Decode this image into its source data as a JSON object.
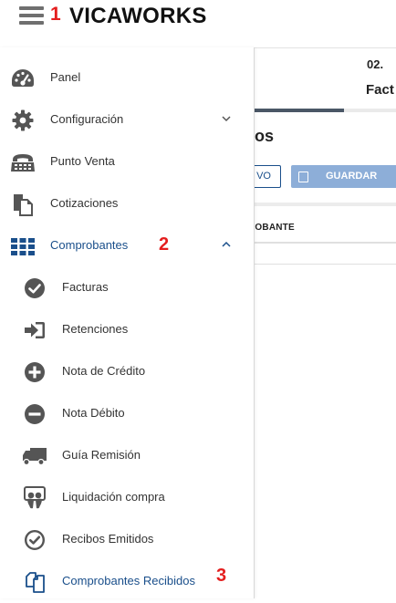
{
  "header": {
    "brand": "VICAWORKS",
    "step_marker": "1"
  },
  "background": {
    "step_number": "02.",
    "step_title": "Fact",
    "progress": 0.62,
    "section_title": "dos",
    "btn_nuevo": "VO",
    "btn_guardar": "GUARDAR",
    "column_header": "ROBANTE"
  },
  "sidebar": {
    "items": [
      {
        "label": "Panel",
        "icon": "dashboard-gauge-icon"
      },
      {
        "label": "Configuración",
        "icon": "gear-icon",
        "expandable": true
      },
      {
        "label": "Punto Venta",
        "icon": "cash-register-icon"
      },
      {
        "label": "Cotizaciones",
        "icon": "documents-icon"
      },
      {
        "label": "Comprobantes",
        "icon": "grid-icon",
        "expanded": true,
        "active": true,
        "step_marker": "2"
      }
    ],
    "subitems": [
      {
        "label": "Facturas",
        "icon": "check-circle-icon"
      },
      {
        "label": "Retenciones",
        "icon": "sign-in-arrow-icon"
      },
      {
        "label": "Nota de Crédito",
        "icon": "plus-circle-icon"
      },
      {
        "label": "Nota Débito",
        "icon": "minus-circle-icon"
      },
      {
        "label": "Guía Remisión",
        "icon": "truck-icon"
      },
      {
        "label": "Liquidación compra",
        "icon": "slideshare-icon"
      },
      {
        "label": "Recibos Emitidos",
        "icon": "check-circle-outline-icon"
      },
      {
        "label": "Comprobantes Recibidos",
        "icon": "copy-icon",
        "active": true,
        "step_marker": "3"
      }
    ]
  },
  "colors": {
    "accent": "#1a4f8b",
    "marker": "#e41e1e",
    "icon": "#555555",
    "save_button": "#8daed8"
  }
}
